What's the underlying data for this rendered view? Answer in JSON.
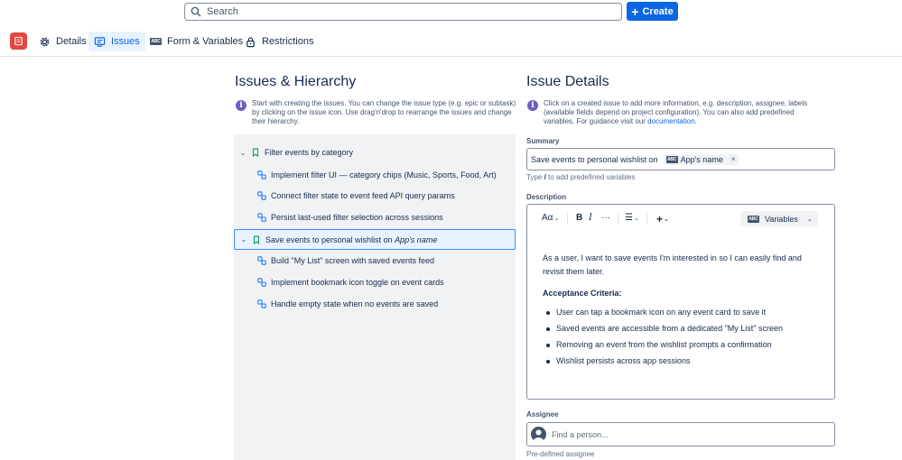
{
  "search": {
    "placeholder": "Search"
  },
  "create_button": {
    "label": "Create"
  },
  "tabs": [
    {
      "label": "Details",
      "icon": "gear-icon"
    },
    {
      "label": "Issues",
      "icon": "issues-icon",
      "active": true
    },
    {
      "label": "Form & Variables",
      "icon": "abc-icon"
    },
    {
      "label": "Restrictions",
      "icon": "lock-icon"
    }
  ],
  "left": {
    "title": "Issues & Hierarchy",
    "info": "Start with creating the issues. You can change the issue type (e.g. epic or subtask) by clicking on the issue icon. Use drag'n'drop to rearrange the issues and change their hierarchy.",
    "tree": [
      {
        "type": "epic",
        "label": "Filter events by category"
      },
      {
        "type": "child",
        "label": "Implement filter UI — category chips (Music, Sports, Food, Art)"
      },
      {
        "type": "child",
        "label": "Connect filter state to event feed API query params"
      },
      {
        "type": "child",
        "label": "Persist last-used filter selection across sessions"
      },
      {
        "type": "epic",
        "label": "Save events to personal wishlist on ",
        "variable": "App's name",
        "selected": true
      },
      {
        "type": "child",
        "label": "Build \"My List\" screen with saved events feed"
      },
      {
        "type": "child",
        "label": "Implement bookmark icon toggle on event cards"
      },
      {
        "type": "child",
        "label": "Handle empty state when no events are saved"
      }
    ]
  },
  "right": {
    "title": "Issue Details",
    "info_text": "Click on a created issue to add more information, e.g. description, assignee, labels (available fields depend on project configuration). You can also add predefined variables. For guidance visit our ",
    "info_link": "documentation",
    "info_end": ".",
    "summary": {
      "label": "Summary",
      "value": "Save events to personal wishlist on",
      "chip_badge": "ABC",
      "chip": "App's name",
      "chip_remove": "×",
      "hint_pre": "Type ",
      "hint_key": "/",
      "hint_post": " to add predefined variables"
    },
    "description": {
      "label": "Description",
      "toolbar": {
        "text_style": "Aα",
        "bold": "B",
        "italic": "I",
        "more": "···",
        "list": "☰",
        "insert": "+",
        "variables": "Variables"
      },
      "paragraph": "As a user, I want to save events I'm interested in so I can easily find and revisit them later.",
      "criteria_title": "Acceptance Criteria:",
      "criteria": [
        "User can tap a bookmark icon on any event card to save it",
        "Saved events are accessible from a dedicated \"My List\" screen",
        "Removing an event from the wishlist prompts a confirmation",
        "Wishlist persists across app sessions"
      ]
    },
    "assignee": {
      "label": "Assignee",
      "placeholder": "Find a person...",
      "hint": "Pre-defined assignee"
    }
  },
  "colors": {
    "accent": "#0c66e4",
    "info": "#6e5dc6",
    "logo": "#e2483d",
    "epic_icon": "#22a06b",
    "subtask_icon": "#1d7afc"
  }
}
